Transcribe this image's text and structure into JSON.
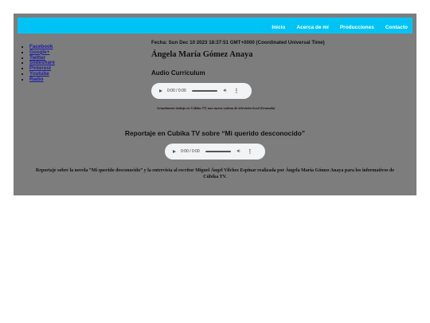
{
  "nav": {
    "items": [
      "Inicio",
      "Acerca de mí",
      "Producciones",
      "Contacto"
    ]
  },
  "sidebar": {
    "links": [
      "Facebook",
      "Google+",
      "Twitter",
      "Slideshare",
      "Pinterest",
      "Youtube",
      "Radio"
    ]
  },
  "main": {
    "date": "Fecha: Sun Dec 10 2023 18:37:51 GMT+0000 (Coordinated Universal Time)",
    "name": "Ángela María Gómez Anaya",
    "audio_title": "Audio Currículum",
    "audio1": {
      "time": "0:00 / 0:00"
    },
    "caption1": "Actualmente trabajo en Cúbika TV, una nueva cadena de televisión local (Granada)",
    "heading2": "Reportaje en Cubika TV sobre “Mi querido desconocido”",
    "audio2": {
      "time": "0:00 / 0:00"
    },
    "caption2": "Reportaje sobre la novela “Mi querido desconocido” y la entrevista al escritor Miguel Ángel Vilchez Espinar realizada por Ángela María Gómez Anaya para los informativos de Cúbika TV."
  },
  "colors": {
    "topbar": "#00c3f5",
    "page_bg": "#7d7d7d",
    "link": "#1a1aa6"
  }
}
